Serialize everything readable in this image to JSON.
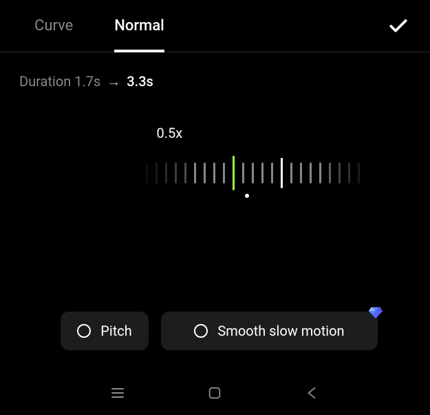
{
  "tabs": {
    "curve": "Curve",
    "normal": "Normal",
    "active": "normal"
  },
  "duration": {
    "label": "Duration",
    "from": "1.7s",
    "to": "3.3s"
  },
  "speed": {
    "value_label": "0.5x",
    "value": 0.5
  },
  "options": {
    "pitch": {
      "label": "Pitch",
      "checked": false
    },
    "smooth": {
      "label": "Smooth slow motion",
      "checked": false,
      "premium": true
    }
  },
  "icons": {
    "confirm": "check-icon",
    "gem": "premium-gem-icon",
    "nav_recent": "recent-apps-icon",
    "nav_home": "home-icon",
    "nav_back": "back-icon"
  }
}
